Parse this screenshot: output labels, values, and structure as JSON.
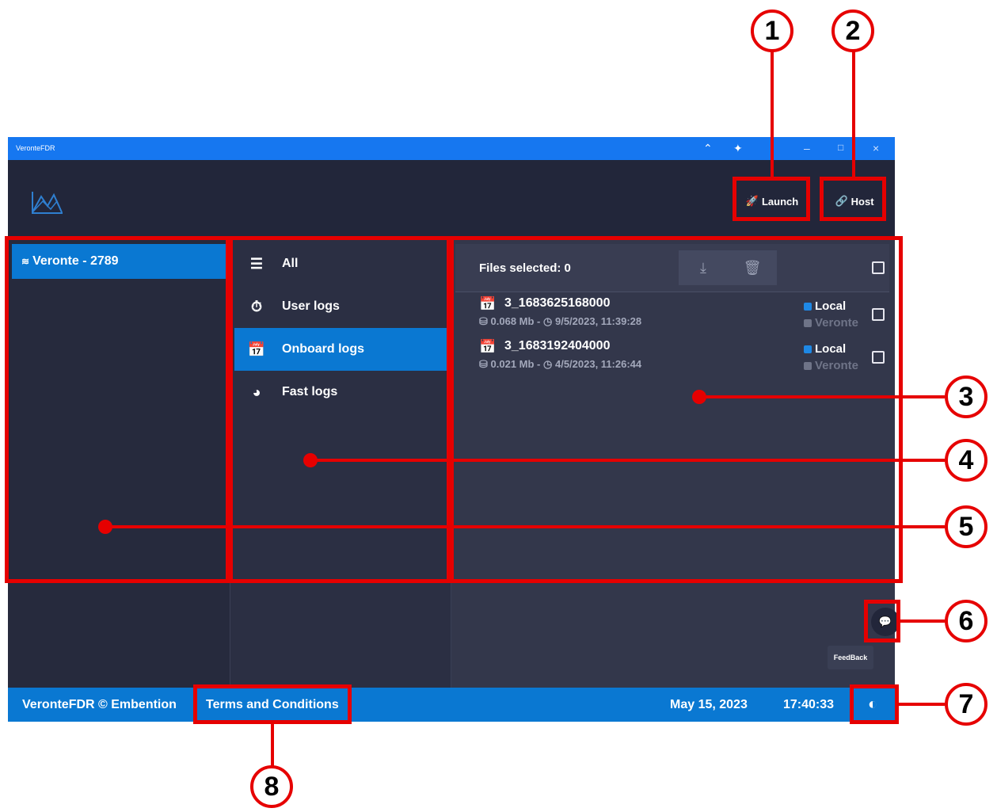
{
  "window": {
    "title": "VeronteFDR"
  },
  "header": {
    "launch_label": "Launch",
    "host_label": "Host"
  },
  "devices": [
    {
      "label": "Veronte - 2789"
    }
  ],
  "nav": [
    {
      "label": "All",
      "icon": "list-icon"
    },
    {
      "label": "User logs",
      "icon": "stopwatch-icon"
    },
    {
      "label": "Onboard logs",
      "icon": "calendar-clock-icon",
      "active": true
    },
    {
      "label": "Fast logs",
      "icon": "speedometer-icon"
    }
  ],
  "files": {
    "selected_label": "Files selected: 0",
    "items": [
      {
        "name": "3_1683625168000",
        "size": "0.068 Mb -",
        "date": "9/5/2023, 11:39:28",
        "local": "Local",
        "veronte": "Veronte"
      },
      {
        "name": "3_1683192404000",
        "size": "0.021 Mb -",
        "date": "4/5/2023, 11:26:44",
        "local": "Local",
        "veronte": "Veronte"
      }
    ]
  },
  "feedback": {
    "label": "FeedBack"
  },
  "footer": {
    "copyright": "VeronteFDR © Embention",
    "terms": "Terms and Conditions",
    "date": "May 15, 2023",
    "time": "17:40:33"
  },
  "annotations": [
    "1",
    "2",
    "3",
    "4",
    "5",
    "6",
    "7",
    "8"
  ],
  "colors": {
    "accent": "#0a78d2",
    "titlebar": "#1677f0",
    "annotation": "#e60000"
  }
}
